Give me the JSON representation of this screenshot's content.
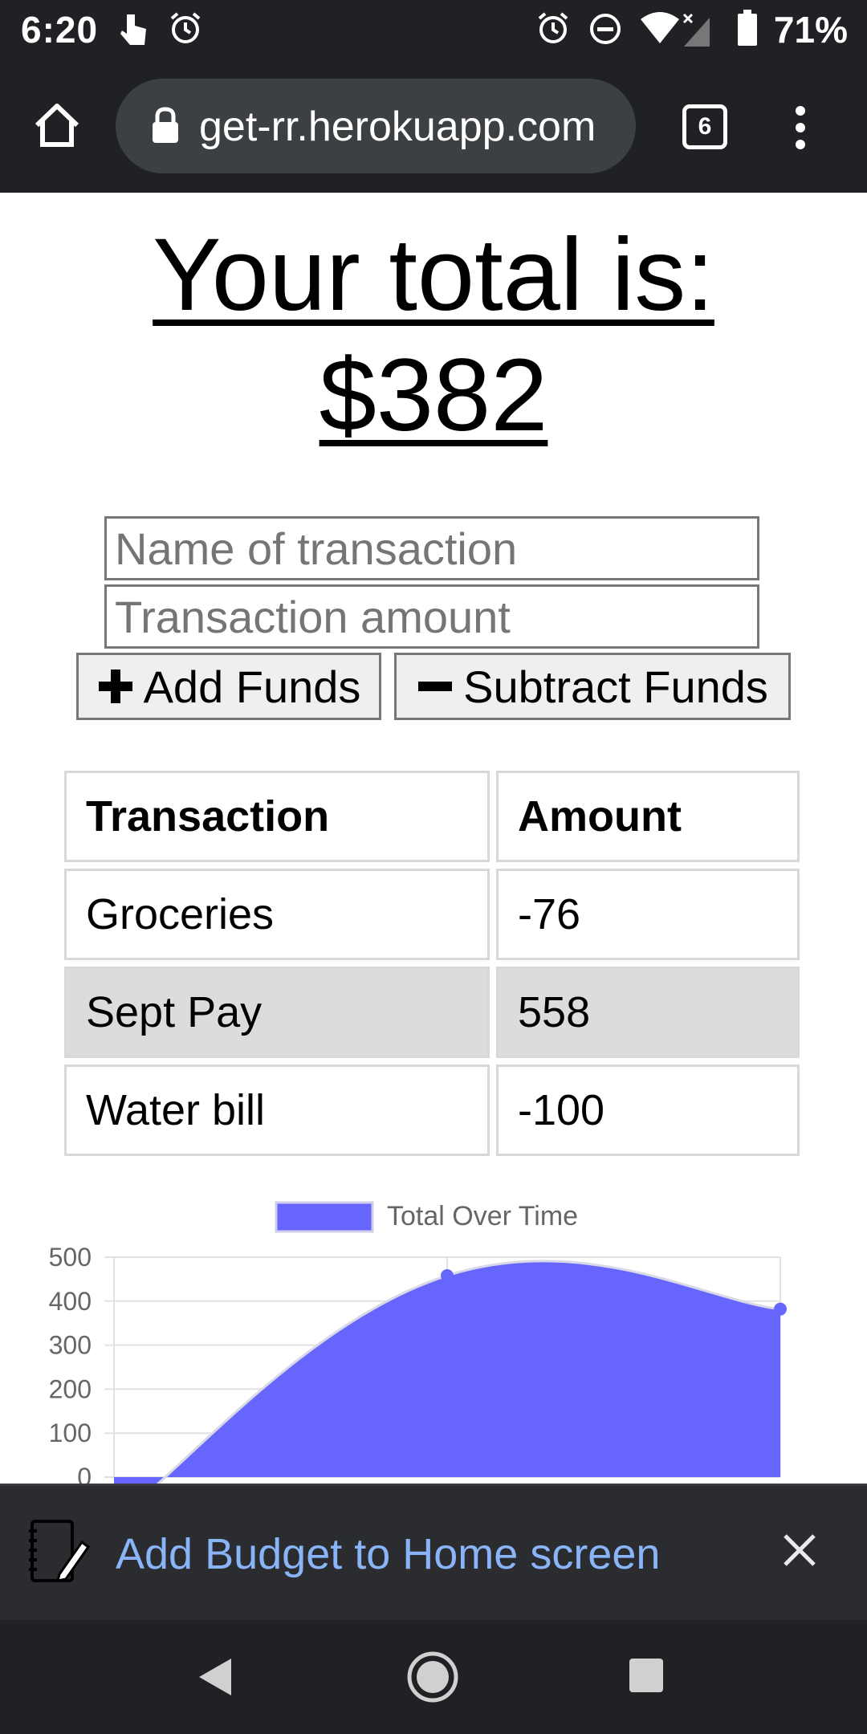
{
  "status_bar": {
    "time": "6:20",
    "battery": "71%"
  },
  "browser": {
    "url": "get-rr.herokuapp.com",
    "tab_count": "6"
  },
  "page": {
    "title_line1": "Your total is:",
    "title_line2": "$382",
    "name_placeholder": "Name of transaction",
    "amount_placeholder": "Transaction amount",
    "add_label": "Add Funds",
    "subtract_label": "Subtract Funds"
  },
  "table": {
    "headers": [
      "Transaction",
      "Amount"
    ],
    "rows": [
      {
        "name": "Groceries",
        "amount": "-76"
      },
      {
        "name": "Sept Pay",
        "amount": "558"
      },
      {
        "name": "Water bill",
        "amount": "-100"
      }
    ]
  },
  "chart_data": {
    "type": "area",
    "x": [
      0,
      1,
      2
    ],
    "series": [
      {
        "name": "Total Over Time",
        "values": [
          -100,
          458,
          382
        ]
      }
    ],
    "ylim": [
      0,
      500
    ],
    "yticks": [
      "500",
      "400",
      "300",
      "200",
      "100",
      "0"
    ],
    "legend": "top",
    "fill_color": "#6666ff",
    "grid": true
  },
  "install_banner": {
    "label": "Add Budget to Home screen"
  },
  "colors": {
    "accent": "#6666ff",
    "dark_bar": "#202124",
    "link": "#8ab4f8"
  }
}
